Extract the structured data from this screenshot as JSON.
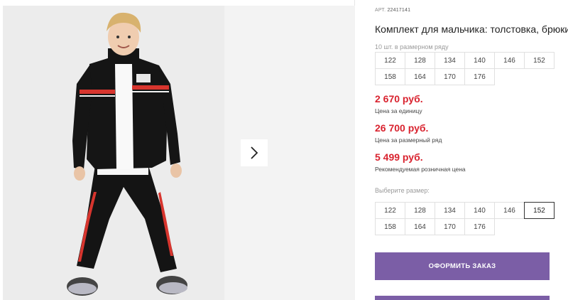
{
  "product": {
    "article_prefix": "АРТ.",
    "article_number": "22417141",
    "title": "Комплект для мальчика: толстовка, брюки",
    "pack_label": "10 шт. в размерном ряду",
    "pack_sizes": [
      "122",
      "128",
      "134",
      "140",
      "146",
      "152",
      "158",
      "164",
      "170",
      "176"
    ]
  },
  "prices": {
    "unit_price": "2 670 руб.",
    "unit_label": "Цена за единицу",
    "row_price": "26 700 руб.",
    "row_label": "Цена за размерный ряд",
    "retail_price": "5 499 руб.",
    "retail_label": "Рекомендуемая розничная цена"
  },
  "size_select": {
    "label": "Выберите размер:",
    "sizes": [
      "122",
      "128",
      "134",
      "140",
      "146",
      "152",
      "158",
      "164",
      "170",
      "176"
    ],
    "selected": "152"
  },
  "actions": {
    "order_label": "ОФОРМИТЬ ЗАКАЗ"
  },
  "icons": {
    "next": "chevron-right-icon"
  },
  "colors": {
    "accent": "#7b5ea6",
    "price": "#d9232f"
  }
}
